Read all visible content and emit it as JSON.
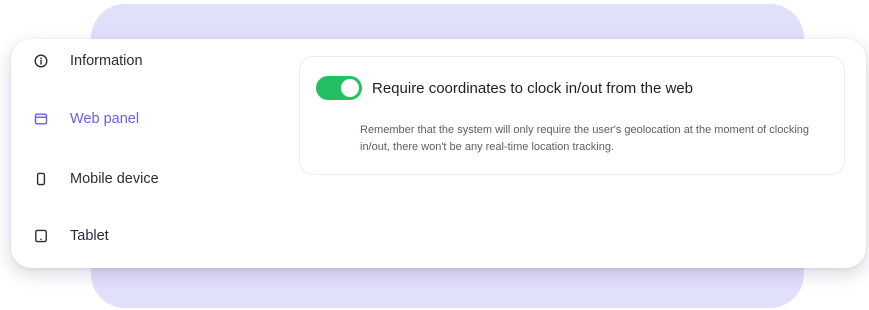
{
  "nav": {
    "items": [
      {
        "label": "Information",
        "icon": "info-circle-icon",
        "active": false
      },
      {
        "label": "Web panel",
        "icon": "browser-window-icon",
        "active": true
      },
      {
        "label": "Mobile device",
        "icon": "mobile-phone-icon",
        "active": false
      },
      {
        "label": "Tablet",
        "icon": "tablet-icon",
        "active": false
      }
    ]
  },
  "setting": {
    "toggle_label": "Require coordinates to clock in/out from the web",
    "toggle_state": "on",
    "note": "Remember that the system will only require the user's geolocation at the moment of clocking in/out, there won't be any real-time location tracking."
  },
  "colors": {
    "accent": "#6b5ce7",
    "backdrop": "#e1e0fb",
    "toggle_on": "#23c063",
    "text": "#2b2b3a"
  }
}
